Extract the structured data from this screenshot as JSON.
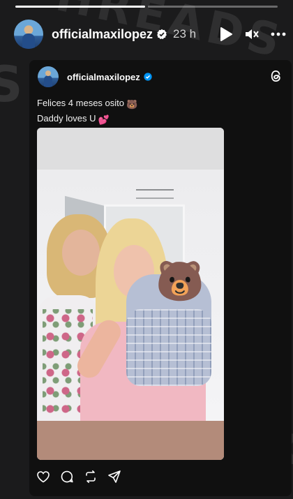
{
  "story": {
    "username": "officialmaxilopez",
    "time": "23 h",
    "progress": [
      1.0,
      0.0
    ]
  },
  "post": {
    "username": "officialmaxilopez",
    "line1": "Felices 4 meses osito",
    "line1_emoji": "🐻",
    "line2": "Daddy loves U",
    "line2_emoji": "💕"
  },
  "icons": {
    "play": "play-icon",
    "mute": "mute-icon",
    "more": "more-icon",
    "threads": "threads-logo-icon",
    "like": "heart-icon",
    "comment": "comment-icon",
    "repost": "repost-icon",
    "share": "share-icon"
  },
  "colors": {
    "background": "#1b1b1c",
    "card": "#101010",
    "verified": "#0095f6"
  }
}
